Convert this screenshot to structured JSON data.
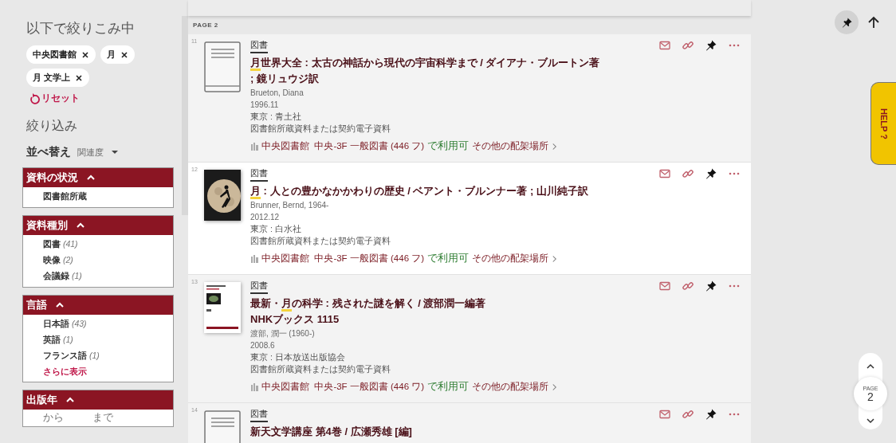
{
  "active_filters": {
    "title": "以下で絞りこみ中",
    "chips": [
      {
        "label": "中央図書館"
      },
      {
        "label": "月"
      },
      {
        "label": "月 文学上"
      }
    ],
    "reset": "リセット"
  },
  "refine": {
    "title": "絞り込み",
    "sort": {
      "label": "並べ替え",
      "value": "関連度"
    },
    "facets": [
      {
        "kind": "list",
        "title": "資料の状況",
        "expanded": true,
        "items": [
          {
            "label": "図書館所蔵"
          }
        ]
      },
      {
        "kind": "list",
        "title": "資料種別",
        "expanded": true,
        "items": [
          {
            "label": "図書",
            "count": "(41)"
          },
          {
            "label": "映像",
            "count": "(2)"
          },
          {
            "label": "会議録",
            "count": "(1)"
          }
        ]
      },
      {
        "kind": "list",
        "title": "言語",
        "expanded": true,
        "items": [
          {
            "label": "日本語",
            "count": "(43)"
          },
          {
            "label": "英語",
            "count": "(1)"
          },
          {
            "label": "フランス語",
            "count": "(1)"
          }
        ],
        "more": "さらに表示"
      },
      {
        "kind": "range",
        "title": "出版年",
        "expanded": true,
        "from_placeholder": "から",
        "to_placeholder": "まで"
      }
    ]
  },
  "results": {
    "page_label": "PAGE 2",
    "items": [
      {
        "index": "11",
        "cover": {
          "kind": "icon"
        },
        "hovered": false,
        "type": "図書",
        "title": [
          {
            "text": "月",
            "hit": true
          },
          {
            "text": "世界大全 : 太古の神話から現代の宇宙科学まで / ダイアナ・ブルートン著 ; 鏡リュウジ訳",
            "hit": false
          }
        ],
        "author": "Brueton, Diana",
        "date": "1996.11",
        "publisher": "東京 : 青土社",
        "source": "図書館所蔵資料または契約電子資料",
        "location": "中央図書館  中央-3F 一般図書 (446 フ)",
        "availability": "で利用可",
        "other": "その他の配架場所"
      },
      {
        "index": "12",
        "cover": {
          "kind": "picture"
        },
        "hovered": true,
        "type": "図書",
        "title": [
          {
            "text": "月",
            "hit": true
          },
          {
            "text": " : 人との豊かなかかわりの歴史 / ベアント・ブルンナー著 ; 山川純子訳",
            "hit": false
          }
        ],
        "author": "Brunner, Bernd, 1964-",
        "date": "2012.12",
        "publisher": "東京 : 白水社",
        "source": "図書館所蔵資料または契約電子資料",
        "location": "中央図書館  中央-3F 一般図書 (446 フ)",
        "availability": "で利用可",
        "other": "その他の配架場所"
      },
      {
        "index": "13",
        "cover": {
          "kind": "picture"
        },
        "hovered": false,
        "type": "図書",
        "title": [
          {
            "text": "最新・",
            "hit": false
          },
          {
            "text": "月",
            "hit": true
          },
          {
            "text": "の科学 : 残された謎を解く / 渡部潤一編著",
            "hit": false
          }
        ],
        "series": "NHKブックス 1115",
        "author": "渡部, 潤一 (1960-)",
        "date": "2008.6",
        "publisher": "東京 : 日本放送出版協会",
        "source": "図書館所蔵資料または契約電子資料",
        "location": "中央図書館  中央-3F 一般図書 (446 ワ)",
        "availability": "で利用可",
        "other": "その他の配架場所"
      },
      {
        "index": "14",
        "cover": {
          "kind": "icon"
        },
        "hovered": false,
        "type": "図書",
        "title": [
          {
            "text": "新天文学講座  第4巻 / 広瀬秀雄 [編]",
            "hit": false
          }
        ]
      }
    ]
  },
  "pager": {
    "label": "PAGE",
    "page": "2"
  },
  "help": "HELP ?"
}
